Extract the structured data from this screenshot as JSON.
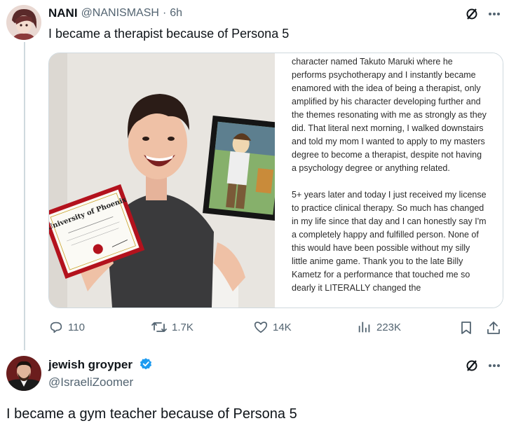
{
  "tweet1": {
    "display_name": "NANI",
    "handle": "@NANISMASH",
    "separator": "·",
    "time": "6h",
    "text": "I became a therapist because of Persona 5",
    "media_text": [
      "character named Takuto Maruki where he performs psychotherapy and I instantly became enamored with the idea of being a therapist, only amplified by his character developing further and the themes resonating with me as strongly as they did. That literal next morning, I walked downstairs and told my mom I wanted to apply to my masters degree to become a therapist, despite not having a psychology degree or anything related.",
      "5+ years later and today I just received my license to practice clinical therapy. So much has changed in my life since that day and I can honestly say I'm a completely happy and fulfilled person. None of this would have been possible without my silly little anime game. Thank you to the late Billy Kametz for a performance that touched me so dearly it LITERALLY changed the"
    ],
    "diploma_title": "University of Phoenix",
    "stats": {
      "replies": "110",
      "reposts": "1.7K",
      "likes": "14K",
      "views": "223K"
    }
  },
  "tweet2": {
    "display_name": "jewish groyper",
    "handle": "@IsraeliZoomer",
    "text": "I became a gym teacher because of Persona 5"
  },
  "icons": {
    "reply": "reply-icon",
    "repost": "repost-icon",
    "like": "heart-icon",
    "views": "views-icon",
    "bookmark": "bookmark-icon",
    "share": "share-icon",
    "grok": "grok-icon",
    "more": "more-icon",
    "verified": "verified-badge-icon"
  },
  "colors": {
    "accent": "#1d9bf0",
    "muted": "#536471",
    "border": "#cfd9de"
  }
}
